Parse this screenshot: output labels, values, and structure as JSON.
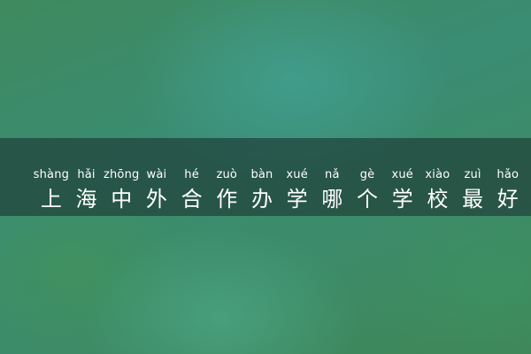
{
  "banner": {
    "pinyin": [
      "shàng",
      "hǎi",
      "zhōng",
      "wài",
      "hé",
      "zuò",
      "bàn",
      "xué",
      "nǎ",
      "gè",
      "xué",
      "xiào",
      "zuì",
      "hǎo"
    ],
    "title": [
      "上",
      "海",
      "中",
      "外",
      "合",
      "作",
      "办",
      "学",
      "哪",
      "个",
      "学",
      "校",
      "最",
      "好"
    ]
  }
}
